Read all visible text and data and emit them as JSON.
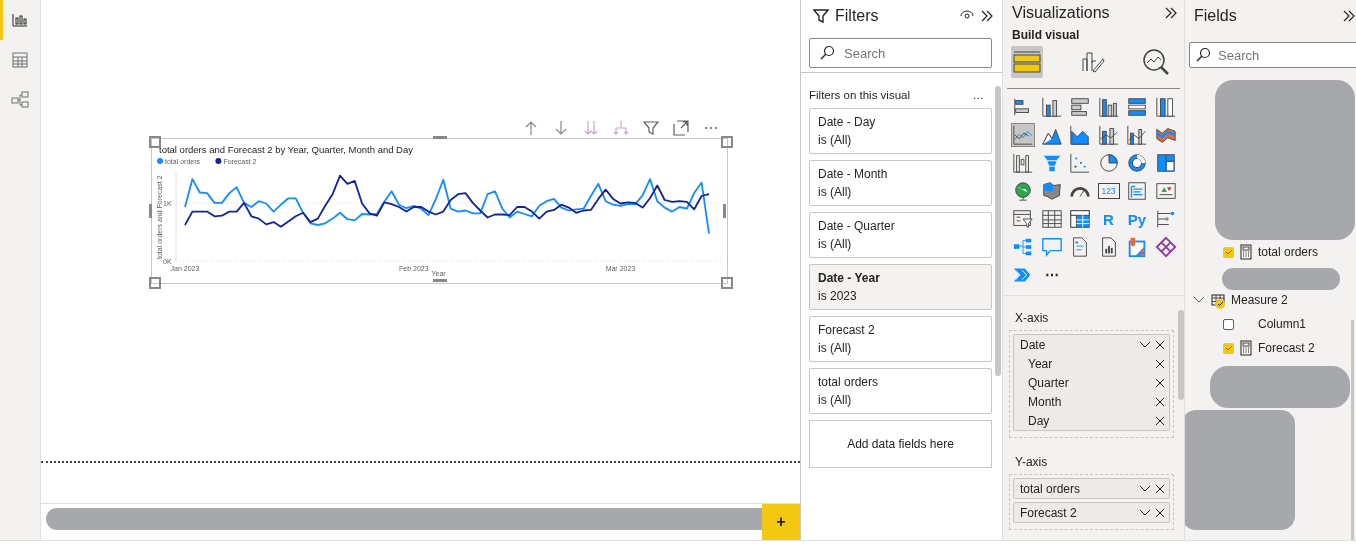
{
  "views": [
    {
      "selected": true
    },
    {
      "selected": false
    },
    {
      "selected": false
    }
  ],
  "visual": {
    "chart_data": {
      "type": "line",
      "title": "total orders and Forecast 2 by Year, Quarter, Month and Day",
      "xlabel": "Year",
      "ylabel": "total orders and Forecast 2",
      "categories": [
        "Jan 2023",
        null,
        null,
        null,
        null,
        null,
        null,
        null,
        null,
        null,
        null,
        null,
        null,
        null,
        null,
        null,
        null,
        null,
        null,
        null,
        null,
        null,
        null,
        null,
        null,
        null,
        null,
        null,
        null,
        null,
        null,
        "Feb 2023",
        null,
        null,
        null,
        null,
        null,
        null,
        null,
        null,
        null,
        null,
        null,
        null,
        null,
        null,
        null,
        null,
        null,
        null,
        null,
        null,
        null,
        null,
        null,
        null,
        null,
        null,
        null,
        "Mar 2023",
        null,
        null,
        null,
        null,
        null,
        null,
        null,
        null,
        null,
        null,
        null,
        null
      ],
      "series": [
        {
          "name": "total orders",
          "color": "#118dff",
          "values": [
            930,
            1410,
            1180,
            1170,
            1000,
            1000,
            1170,
            1270,
            1000,
            930,
            1030,
            990,
            850,
            970,
            1080,
            1080,
            830,
            650,
            620,
            650,
            730,
            830,
            720,
            700,
            810,
            800,
            810,
            1020,
            1200,
            970,
            910,
            950,
            900,
            790,
            1070,
            1400,
            900,
            850,
            870,
            820,
            820,
            1150,
            1200,
            900,
            750,
            850,
            810,
            770,
            950,
            1030,
            1070,
            920,
            870,
            890,
            900,
            1120,
            1330,
            1030,
            970,
            950,
            980,
            980,
            1130,
            1410,
            1030,
            920,
            850,
            930,
            900,
            1170,
            1350,
            470
          ]
        },
        {
          "name": "Forecast 2",
          "color": "#12239e",
          "values": [
            620,
            850,
            850,
            850,
            770,
            780,
            850,
            850,
            1000,
            770,
            730,
            630,
            670,
            590,
            680,
            770,
            830,
            670,
            730,
            950,
            1150,
            1470,
            1330,
            1380,
            990,
            820,
            780,
            1010,
            980,
            930,
            850,
            930,
            930,
            850,
            800,
            850,
            1050,
            1150,
            1170,
            1000,
            870,
            750,
            800,
            800,
            790,
            930,
            930,
            850,
            730,
            850,
            880,
            970,
            920,
            830,
            870,
            880,
            1070,
            1230,
            1070,
            990,
            1010,
            1000,
            920,
            1080,
            1300,
            1050,
            1020,
            1030,
            1020,
            890,
            1120,
            1150
          ]
        }
      ],
      "legend": "top",
      "ylim": [
        0,
        1550
      ],
      "yticks": [
        {
          "value": 0,
          "label": "0K"
        },
        {
          "value": 1000,
          "label": "1K"
        }
      ]
    }
  },
  "page_tabs": {
    "add_button": "+"
  },
  "filters": {
    "title": "Filters",
    "search": {
      "placeholder": "Search"
    },
    "section": "Filters on this visual",
    "more": "…",
    "cards": [
      {
        "title": "Date - Day",
        "value": "is (All)",
        "selected": false
      },
      {
        "title": "Date - Month",
        "value": "is (All)",
        "selected": false
      },
      {
        "title": "Date - Quarter",
        "value": "is (All)",
        "selected": false
      },
      {
        "title": "Date - Year",
        "value": "is 2023",
        "selected": true
      },
      {
        "title": "Forecast 2",
        "value": "is (All)",
        "selected": false
      },
      {
        "title": "total orders",
        "value": "is (All)",
        "selected": false
      }
    ],
    "add_fields": "Add data fields here"
  },
  "visualizations": {
    "title": "Visualizations",
    "subtitle": "Build visual",
    "build_tabs": [
      {
        "selected": true
      },
      {
        "selected": false
      },
      {
        "selected": false
      }
    ],
    "types": [
      {
        "selected": false
      },
      {
        "selected": false
      },
      {
        "selected": false
      },
      {
        "selected": false
      },
      {
        "selected": false
      },
      {
        "selected": false
      },
      {
        "selected": true
      },
      {
        "selected": false
      },
      {
        "selected": false
      },
      {
        "selected": false
      },
      {
        "selected": false
      },
      {
        "selected": false
      },
      {
        "selected": false
      },
      {
        "selected": false
      },
      {
        "selected": false
      },
      {
        "selected": false
      },
      {
        "selected": false
      },
      {
        "selected": false
      },
      {
        "selected": false
      },
      {
        "selected": false
      },
      {
        "selected": false
      },
      {
        "selected": false,
        "glyph": "123"
      },
      {
        "selected": false
      },
      {
        "selected": false
      },
      {
        "selected": false
      },
      {
        "selected": false
      },
      {
        "selected": false
      },
      {
        "selected": false,
        "glyph": "R"
      },
      {
        "selected": false,
        "glyph": "Py"
      },
      {
        "selected": false
      },
      {
        "selected": false
      },
      {
        "selected": false
      },
      {
        "selected": false
      },
      {
        "selected": false
      },
      {
        "selected": false
      },
      {
        "selected": false
      },
      {
        "selected": false
      }
    ],
    "more": "⋯",
    "wells": [
      {
        "label": "X-axis",
        "fields": [
          {
            "name": "Date",
            "children": [
              {
                "name": "Year"
              },
              {
                "name": "Quarter"
              },
              {
                "name": "Month"
              },
              {
                "name": "Day"
              }
            ]
          }
        ]
      },
      {
        "label": "Y-axis",
        "fields": [
          {
            "name": "total orders"
          },
          {
            "name": "Forecast 2"
          }
        ]
      }
    ]
  },
  "fields": {
    "title": "Fields",
    "search": {
      "placeholder": "Search"
    },
    "tree": [
      {
        "label": "total orders",
        "kind": "measure",
        "checked": true
      },
      {
        "label": "Measure 2",
        "kind": "table",
        "expanded": true,
        "checked": true,
        "children": [
          {
            "label": "Column1",
            "kind": "column",
            "checked": false
          },
          {
            "label": "Forecast 2",
            "kind": "measure",
            "checked": true
          }
        ]
      }
    ]
  }
}
